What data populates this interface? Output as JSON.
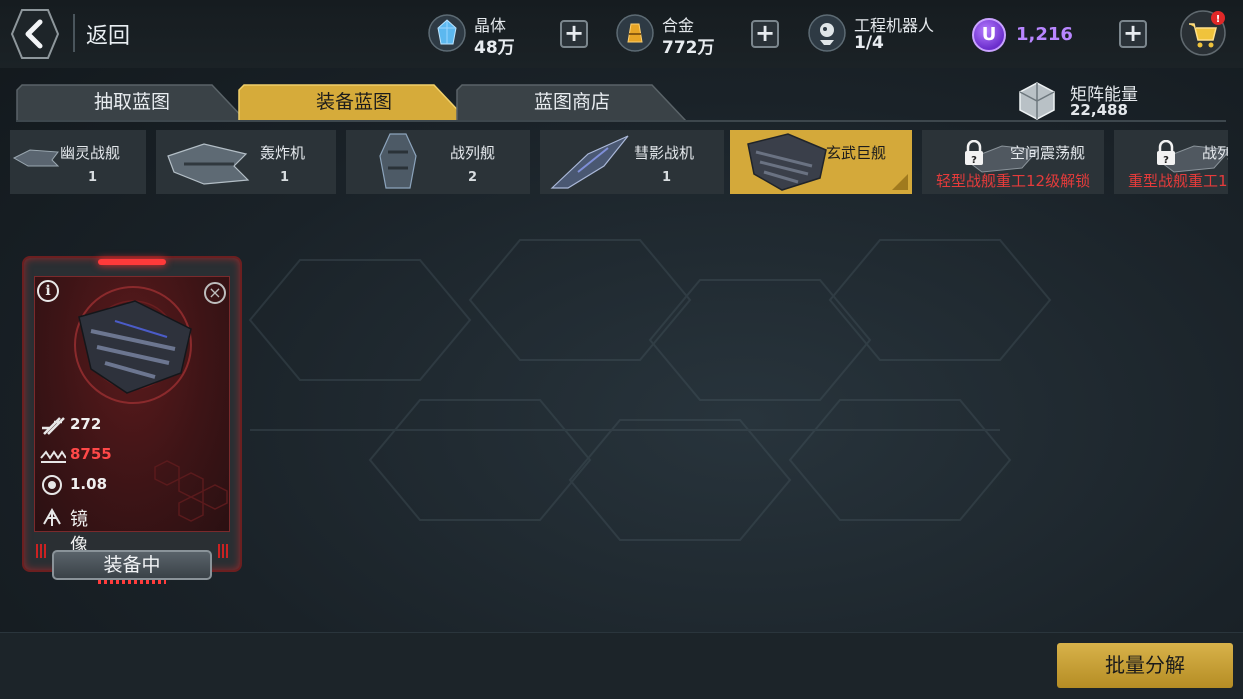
{
  "header": {
    "back_label": "返回",
    "resources": [
      {
        "name": "晶体",
        "value": "48万",
        "icon": "crystal-icon"
      },
      {
        "name": "合金",
        "value": "772万",
        "icon": "alloy-icon"
      },
      {
        "name": "工程机器人",
        "value": "1/4",
        "icon": "robot-icon"
      }
    ],
    "premium_currency": {
      "symbol": "U",
      "value": "1,216"
    },
    "cart_badge": "!"
  },
  "tabs": [
    {
      "label": "抽取蓝图",
      "active": false
    },
    {
      "label": "装备蓝图",
      "active": true
    },
    {
      "label": "蓝图商店",
      "active": false
    }
  ],
  "matrix_energy": {
    "label": "矩阵能量",
    "value": "22,488"
  },
  "ships": [
    {
      "name": "幽灵战舰",
      "count": "1",
      "selected": false,
      "locked": false
    },
    {
      "name": "轰炸机",
      "count": "1",
      "selected": false,
      "locked": false
    },
    {
      "name": "战列舰",
      "count": "2",
      "selected": false,
      "locked": false
    },
    {
      "name": "彗影战机",
      "count": "1",
      "selected": false,
      "locked": false
    },
    {
      "name": "玄武巨舰",
      "count": "",
      "selected": true,
      "locked": false
    },
    {
      "name": "空间震荡舰",
      "lock_message": "轻型战舰重工12级解锁",
      "selected": false,
      "locked": true
    },
    {
      "name": "战列",
      "lock_message": "重型战舰重工1",
      "selected": false,
      "locked": true
    }
  ],
  "blueprint_card": {
    "stats": [
      {
        "icon": "attack-icon",
        "value": "272"
      },
      {
        "icon": "hp-icon",
        "value": "8755"
      },
      {
        "icon": "speed-icon",
        "value": "1.08"
      },
      {
        "icon": "mirror-icon",
        "value": "镜像"
      }
    ],
    "status_label": "装备中"
  },
  "batch_button_label": "批量分解",
  "colors": {
    "accent_gold": "#d4a93a",
    "danger_red": "#e53b3b",
    "premium_purple": "#b886ff"
  }
}
